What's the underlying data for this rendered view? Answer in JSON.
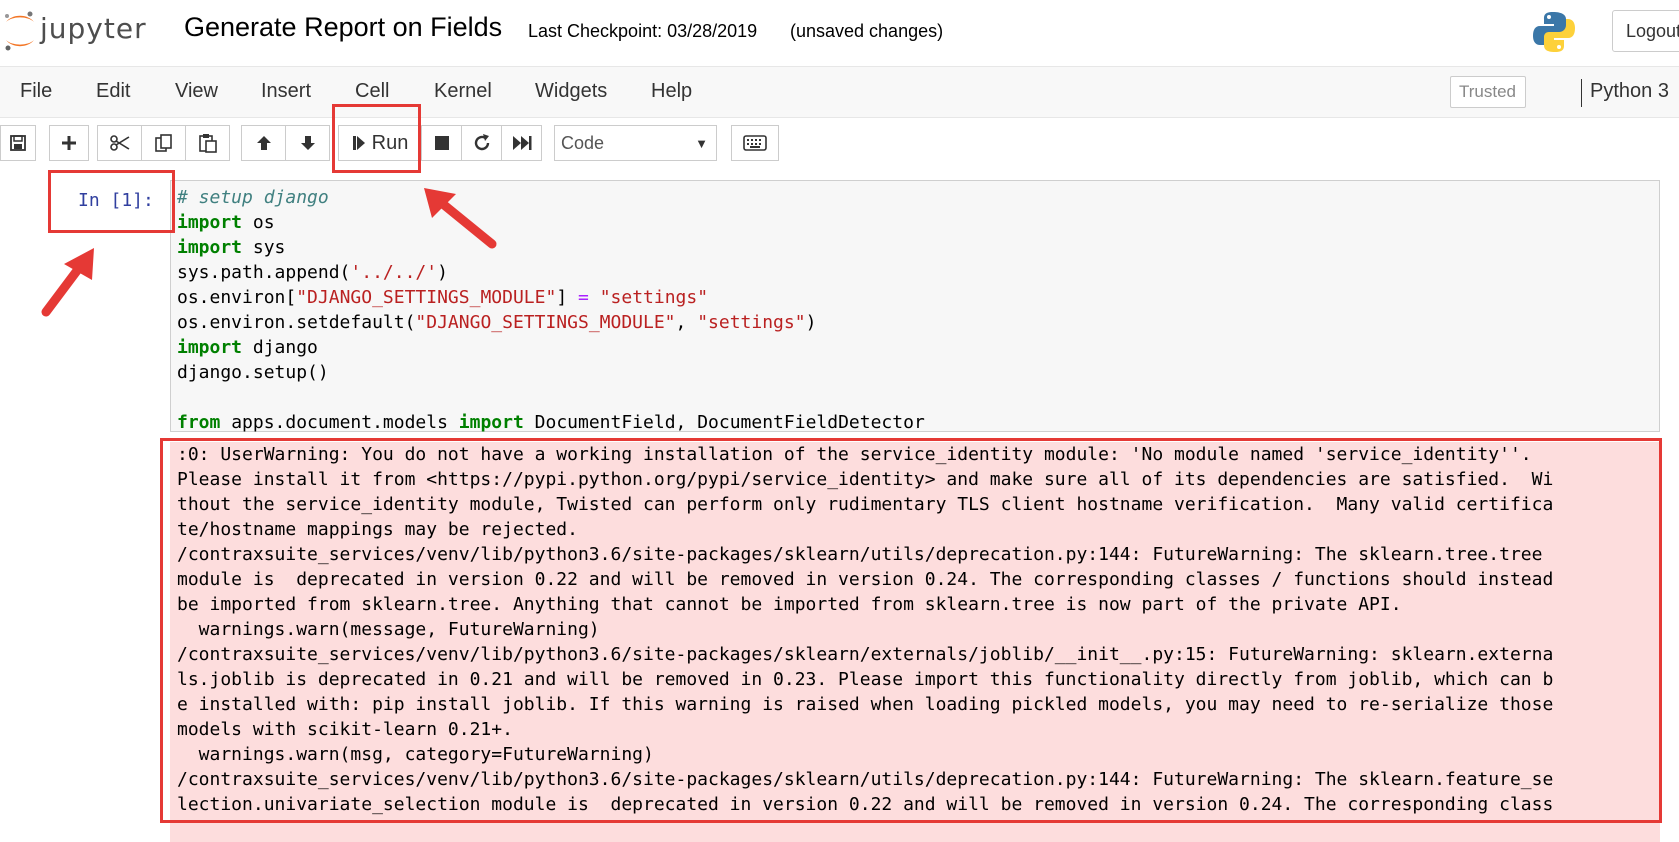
{
  "header": {
    "logo_text": "jupyter",
    "notebook_title": "Generate Report on Fields",
    "checkpoint": "Last Checkpoint: 03/28/2019",
    "save_status": "(unsaved changes)",
    "logout_label": "Logout"
  },
  "menubar": {
    "items": [
      "File",
      "Edit",
      "View",
      "Insert",
      "Cell",
      "Kernel",
      "Widgets",
      "Help"
    ],
    "trusted_label": "Trusted",
    "kernel_name": "Python 3"
  },
  "toolbar": {
    "run_label": "Run",
    "cell_type": "Code",
    "icons": [
      "save-icon",
      "plus-icon",
      "cut-icon",
      "copy-icon",
      "paste-icon",
      "arrow-up-icon",
      "arrow-down-icon",
      "step-forward-icon",
      "stop-icon",
      "restart-icon",
      "fast-forward-icon",
      "keyboard-icon"
    ]
  },
  "cell": {
    "prompt": "In [1]:",
    "code_lines": [
      [
        {
          "t": "# setup django",
          "c": "comment"
        }
      ],
      [
        {
          "t": "import",
          "c": "kw"
        },
        {
          "t": " os",
          "c": ""
        }
      ],
      [
        {
          "t": "import",
          "c": "kw"
        },
        {
          "t": " sys",
          "c": ""
        }
      ],
      [
        {
          "t": "sys.path.append(",
          "c": ""
        },
        {
          "t": "'../../'",
          "c": "str"
        },
        {
          "t": ")",
          "c": ""
        }
      ],
      [
        {
          "t": "os.environ[",
          "c": ""
        },
        {
          "t": "\"DJANGO_SETTINGS_MODULE\"",
          "c": "str"
        },
        {
          "t": "] ",
          "c": ""
        },
        {
          "t": "=",
          "c": "op"
        },
        {
          "t": " ",
          "c": ""
        },
        {
          "t": "\"settings\"",
          "c": "str"
        }
      ],
      [
        {
          "t": "os.environ.setdefault(",
          "c": ""
        },
        {
          "t": "\"DJANGO_SETTINGS_MODULE\"",
          "c": "str"
        },
        {
          "t": ", ",
          "c": ""
        },
        {
          "t": "\"settings\"",
          "c": "str"
        },
        {
          "t": ")",
          "c": ""
        }
      ],
      [
        {
          "t": "import",
          "c": "kw"
        },
        {
          "t": " django",
          "c": ""
        }
      ],
      [
        {
          "t": "django.setup()",
          "c": ""
        }
      ],
      [
        {
          "t": "",
          "c": ""
        }
      ],
      [
        {
          "t": "from",
          "c": "kw"
        },
        {
          "t": " apps.document.models ",
          "c": ""
        },
        {
          "t": "import",
          "c": "kw"
        },
        {
          "t": " DocumentField, DocumentFieldDetector",
          "c": ""
        }
      ]
    ],
    "output_lines": [
      ":0: UserWarning: You do not have a working installation of the service_identity module: 'No module named 'service_identity''.",
      "Please install it from <https://pypi.python.org/pypi/service_identity> and make sure all of its dependencies are satisfied.  Wi",
      "thout the service_identity module, Twisted can perform only rudimentary TLS client hostname verification.  Many valid certifica",
      "te/hostname mappings may be rejected.",
      "/contraxsuite_services/venv/lib/python3.6/site-packages/sklearn/utils/deprecation.py:144: FutureWarning: The sklearn.tree.tree",
      "module is  deprecated in version 0.22 and will be removed in version 0.24. The corresponding classes / functions should instead",
      "be imported from sklearn.tree. Anything that cannot be imported from sklearn.tree is now part of the private API.",
      "  warnings.warn(message, FutureWarning)",
      "/contraxsuite_services/venv/lib/python3.6/site-packages/sklearn/externals/joblib/__init__.py:15: FutureWarning: sklearn.externa",
      "ls.joblib is deprecated in 0.21 and will be removed in 0.23. Please import this functionality directly from joblib, which can b",
      "e installed with: pip install joblib. If this warning is raised when loading pickled models, you may need to re-serialize those",
      "models with scikit-learn 0.21+.",
      "  warnings.warn(msg, category=FutureWarning)",
      "/contraxsuite_services/venv/lib/python3.6/site-packages/sklearn/utils/deprecation.py:144: FutureWarning: The sklearn.feature_se",
      "lection.univariate_selection module is  deprecated in version 0.22 and will be removed in version 0.24. The corresponding class"
    ]
  },
  "colors": {
    "annotation": "#e53935",
    "stderr_bg": "#fddddd",
    "prompt": "#303f9f",
    "jupyter_orange": "#f37626"
  }
}
